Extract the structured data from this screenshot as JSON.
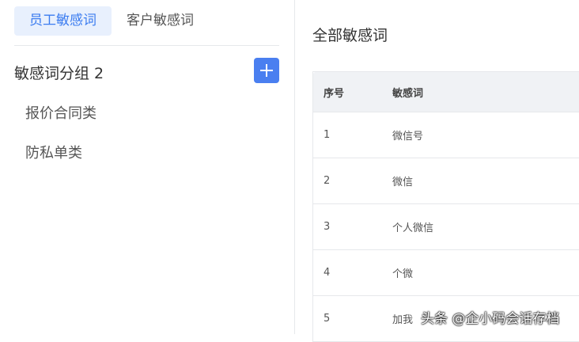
{
  "tabs": [
    {
      "label": "员工敏感词",
      "active": true
    },
    {
      "label": "客户敏感词",
      "active": false
    }
  ],
  "group": {
    "title": "敏感词分组 2",
    "add_icon": "plus-icon"
  },
  "categories": [
    {
      "label": "报价合同类"
    },
    {
      "label": "防私单类"
    }
  ],
  "main": {
    "title": "全部敏感词",
    "table": {
      "headers": [
        "序号",
        "敏感词"
      ],
      "rows": [
        {
          "idx": "1",
          "word": "微信号"
        },
        {
          "idx": "2",
          "word": "微信"
        },
        {
          "idx": "3",
          "word": "个人微信"
        },
        {
          "idx": "4",
          "word": "个微"
        },
        {
          "idx": "5",
          "word": "加我"
        }
      ]
    }
  },
  "watermark": "头条 @企小码会话存档",
  "colors": {
    "accent": "#4a7ff0",
    "tab_active_bg": "#e8f0fd",
    "header_bg": "#f0f2f5"
  }
}
